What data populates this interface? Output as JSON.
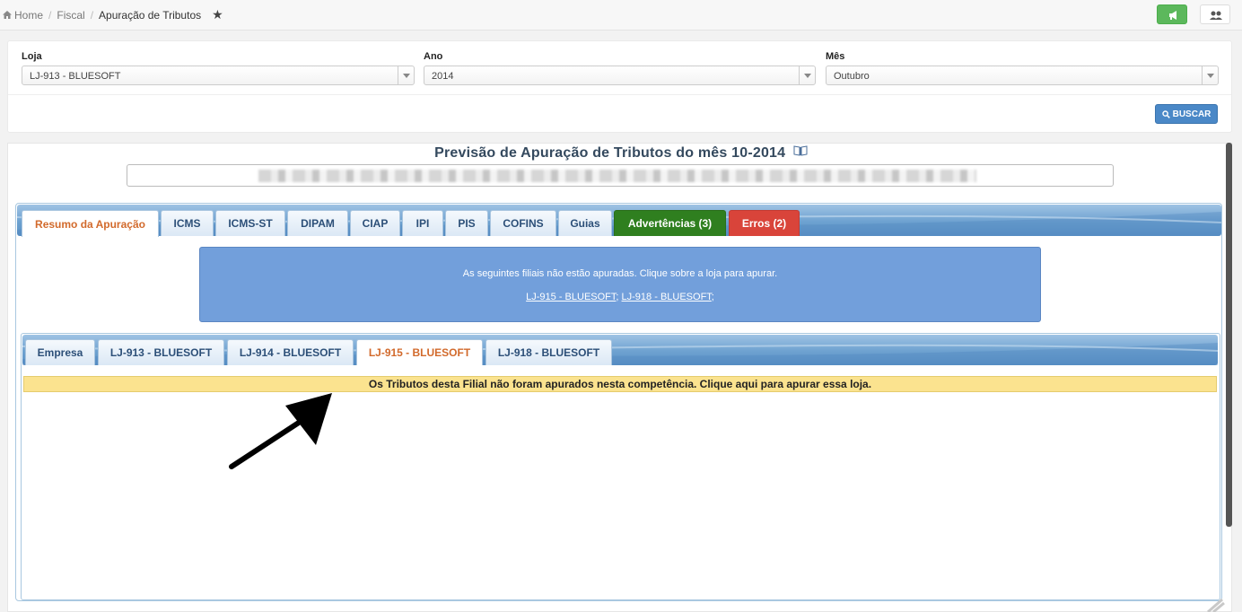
{
  "breadcrumb": {
    "home": "Home",
    "fiscal": "Fiscal",
    "current": "Apuração de Tributos",
    "star": "★"
  },
  "filters": {
    "loja": {
      "label": "Loja",
      "value": "LJ-913 - BLUESOFT"
    },
    "ano": {
      "label": "Ano",
      "value": "2014"
    },
    "mes": {
      "label": "Mês",
      "value": "Outubro"
    },
    "buscar_label": "BUSCAR"
  },
  "title": "Previsão de Apuração de Tributos do mês 10-2014",
  "main_tabs": [
    {
      "label": "Resumo da Apuração",
      "state": "active"
    },
    {
      "label": "ICMS"
    },
    {
      "label": "ICMS-ST"
    },
    {
      "label": "DIPAM"
    },
    {
      "label": "CIAP"
    },
    {
      "label": "IPI"
    },
    {
      "label": "PIS"
    },
    {
      "label": "COFINS"
    },
    {
      "label": "Guias"
    },
    {
      "label": "Advertências (3)",
      "state": "warning"
    },
    {
      "label": "Erros (2)",
      "state": "error"
    }
  ],
  "notice": {
    "message": "As seguintes filiais não estão apuradas. Clique sobre a loja para apurar.",
    "links": [
      "LJ-915 - BLUESOFT",
      "LJ-918 - BLUESOFT"
    ],
    "separator": ";"
  },
  "store_tabs": [
    {
      "label": "Empresa"
    },
    {
      "label": "LJ-913 - BLUESOFT"
    },
    {
      "label": "LJ-914 - BLUESOFT"
    },
    {
      "label": "LJ-915 - BLUESOFT",
      "state": "active"
    },
    {
      "label": "LJ-918 - BLUESOFT"
    }
  ],
  "warning_bar": "Os Tributos desta Filial não foram apurados nesta competência. Clique aqui para apurar essa loja.",
  "colors": {
    "accent": "#4a88c7",
    "tab_active_text": "#d26a2c",
    "warning_tab": "#2f7f1f",
    "error_tab": "#d9443a",
    "notice_bg": "#729fdb",
    "warn_bar_bg": "#fbe38f"
  }
}
